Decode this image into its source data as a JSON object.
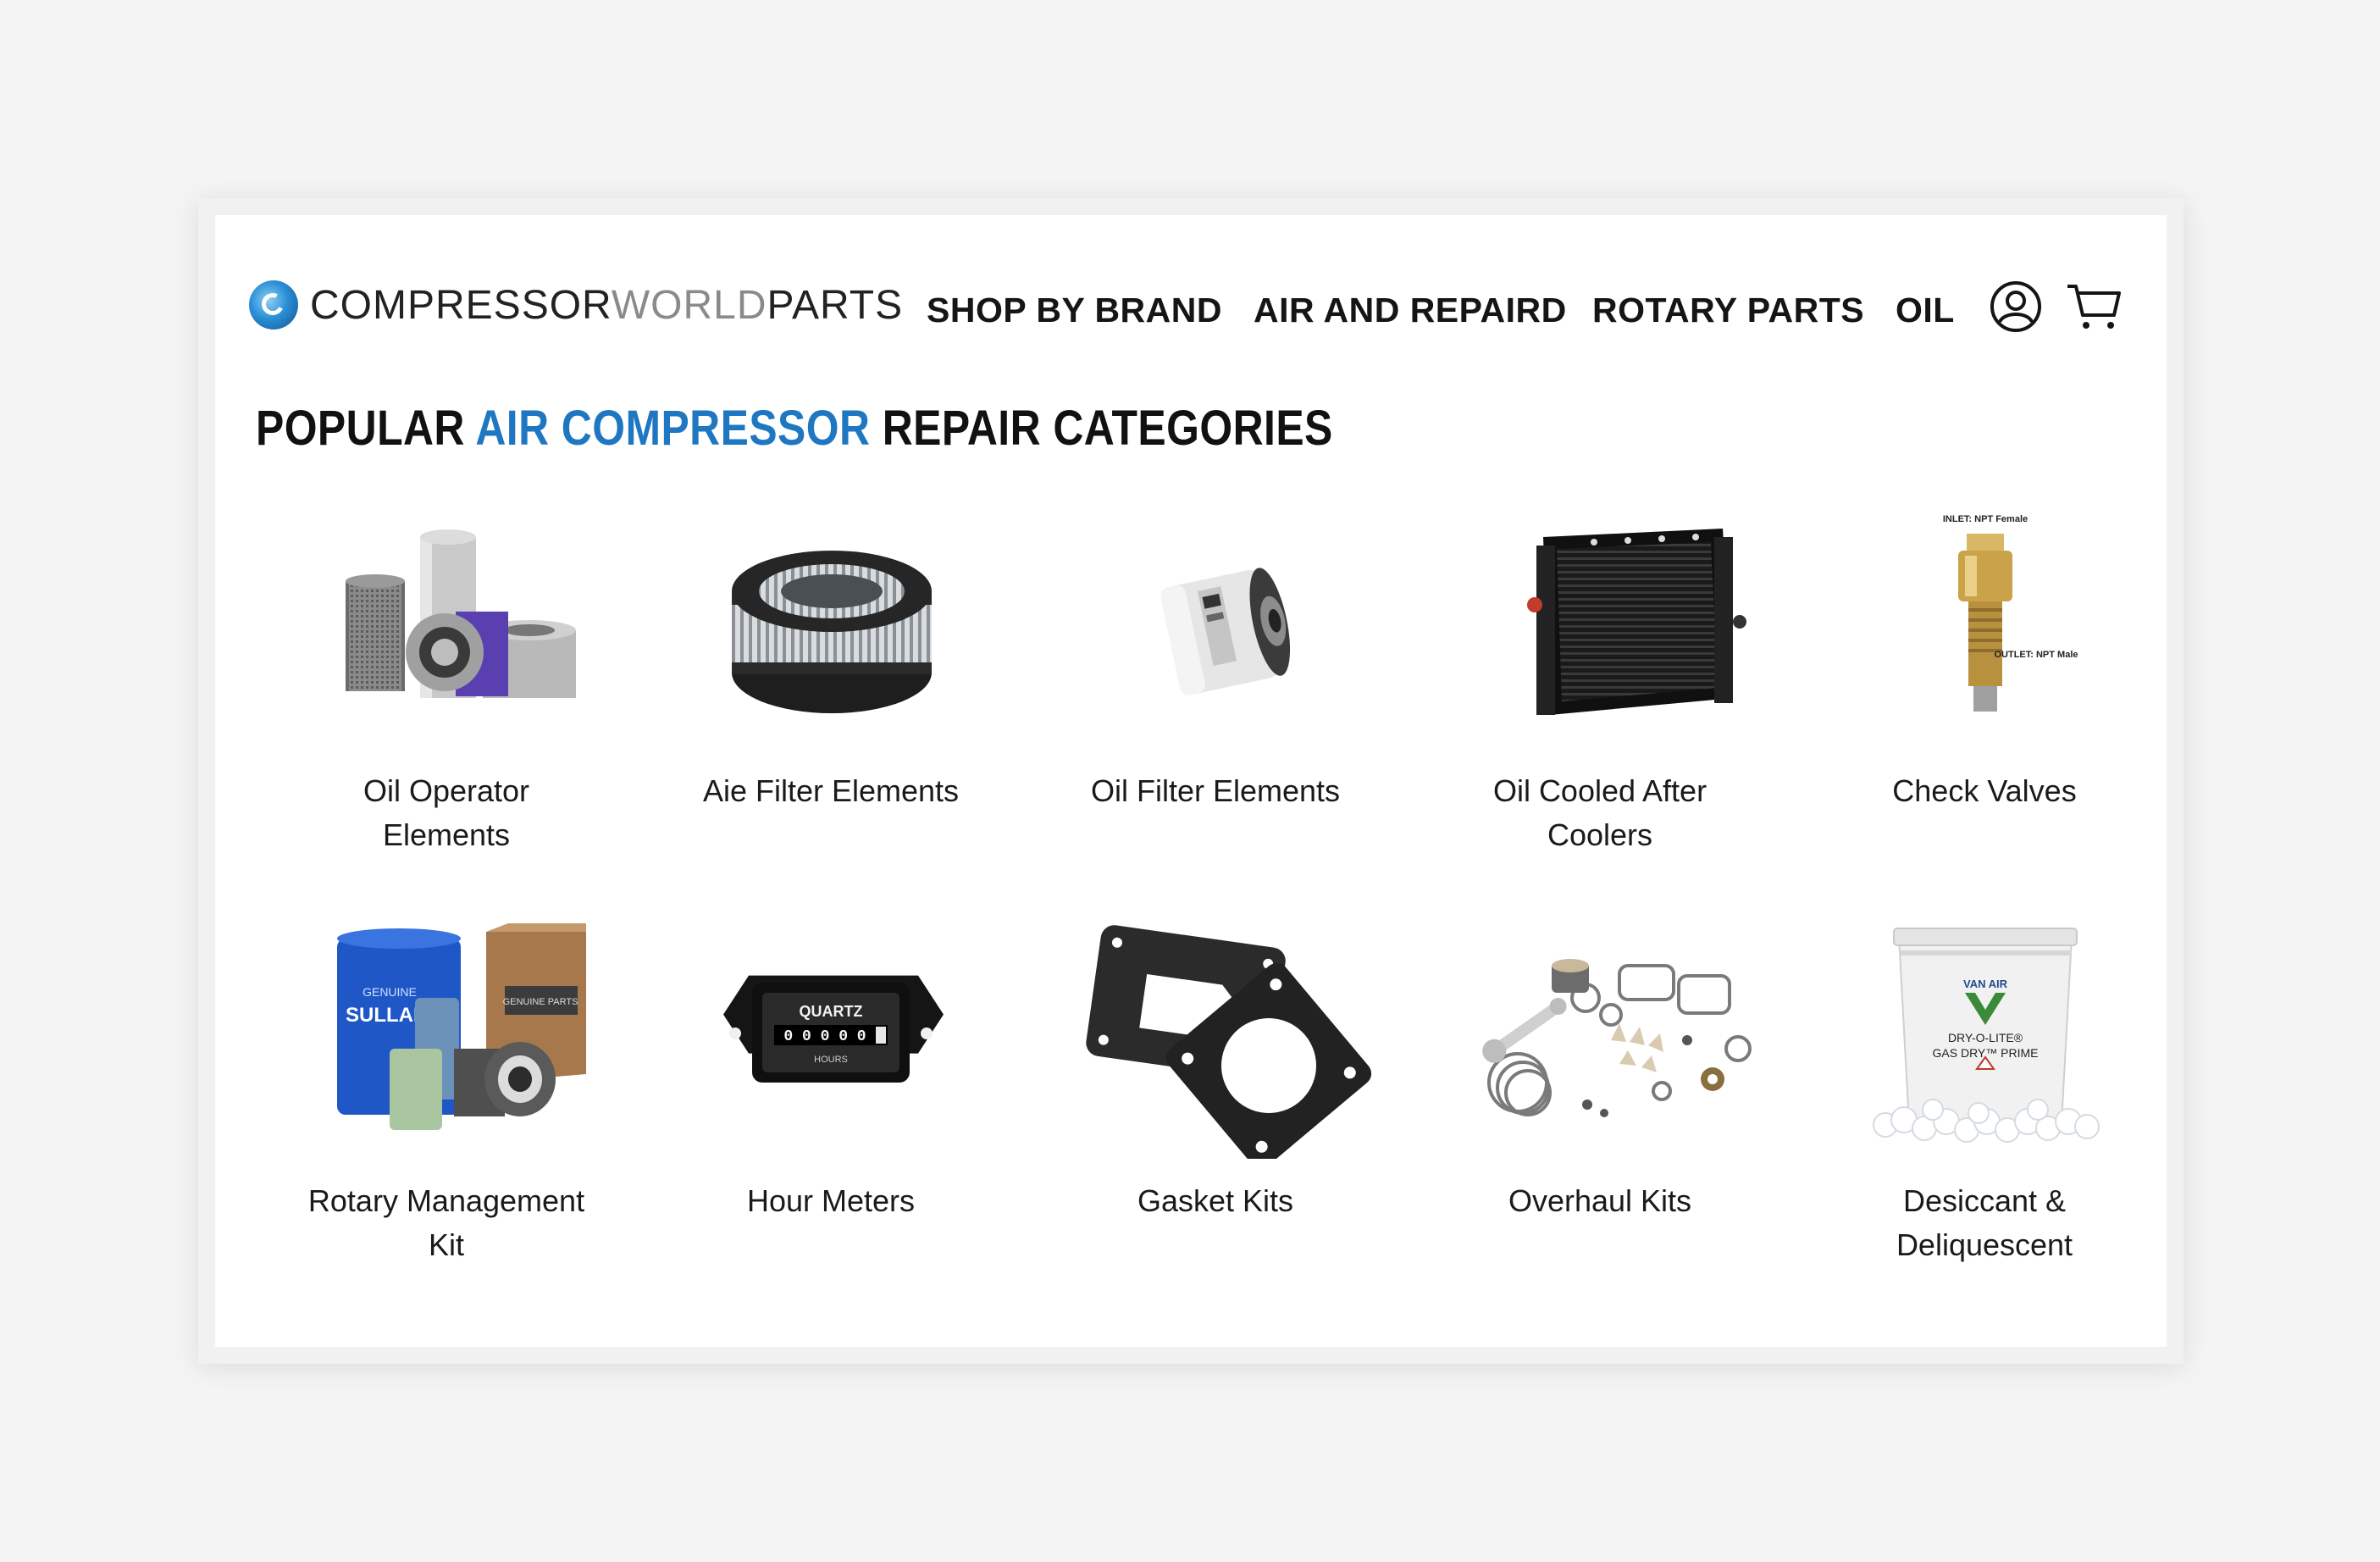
{
  "header": {
    "logo_bold_1": "COMPRESSOR",
    "logo_light": "WORLD",
    "logo_bold_2": "PARTS",
    "nav": [
      {
        "label": "SHOP BY BRAND"
      },
      {
        "label": "AIR AND REPAIRD"
      },
      {
        "label": "ROTARY PARTS"
      },
      {
        "label": "OIL"
      }
    ],
    "icons": [
      "user-icon",
      "cart-icon"
    ]
  },
  "section": {
    "title_part1": "POPULAR ",
    "title_accent": "AIR COMPRESSOR",
    "title_part2": " REPAIR CATEGORIES",
    "accent_color": "#1f77c2"
  },
  "categories": [
    {
      "label": "Oil Operator Elements"
    },
    {
      "label": "Aie Filter Elements"
    },
    {
      "label": "Oil Filter Elements"
    },
    {
      "label": "Oil Cooled After Coolers"
    },
    {
      "label": "Check Valves"
    },
    {
      "label": "Rotary Management Kit"
    },
    {
      "label": "Hour Meters"
    },
    {
      "label": "Gasket Kits"
    },
    {
      "label": "Overhaul Kits"
    },
    {
      "label": "Desiccant & Deliquescent"
    }
  ],
  "product_text": {
    "valve_inlet": "INLET: NPT Female",
    "valve_outlet": "OUTLET: NPT Male",
    "meter_brand": "QUARTZ",
    "meter_digits": "0 0 0 0 0",
    "meter_unit": "HOURS",
    "kit_brand": "SULLAIR",
    "kit_genuine": "GENUINE",
    "kit_box": "GENUINE PARTS",
    "bucket_brand": "VAN AIR",
    "bucket_product": "DRY-O-LITE®",
    "bucket_sub": "GAS DRY™ PRIME"
  }
}
